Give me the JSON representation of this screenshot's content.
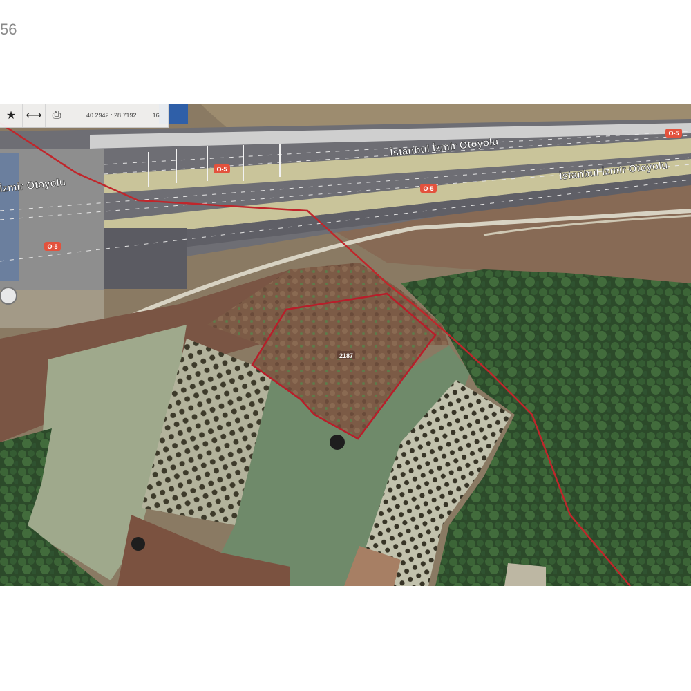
{
  "header": {
    "corner_text": "56"
  },
  "toolbar": {
    "star_icon": "★",
    "measure_icon": "⟷",
    "print_icon": "⎙",
    "coordinates": "40.2942 : 28.7192",
    "zoom_level": "16"
  },
  "map": {
    "road_labels": [
      "İstanbul İzmir Otoyolu",
      "İstanbul İzmir Otoyolu",
      "İzmir Otoyolu"
    ],
    "shields": [
      "O-5",
      "O-5",
      "O-5",
      "O-5"
    ],
    "parcel_label": "2187",
    "colors": {
      "boundary_line": "#c0262b",
      "parcel_outline": "#b81e2a",
      "road_shield": "#e3523d",
      "highway_band": "#c9c49a"
    }
  }
}
